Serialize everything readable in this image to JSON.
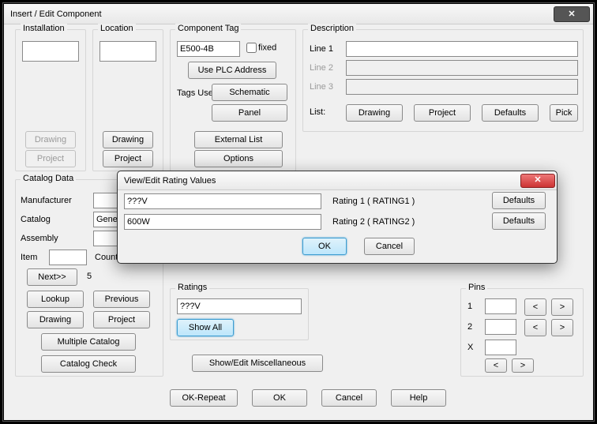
{
  "window": {
    "title": "Insert / Edit Component"
  },
  "installation": {
    "label": "Installation",
    "value": "",
    "drawing": "Drawing",
    "project": "Project"
  },
  "location": {
    "label": "Location",
    "value": "",
    "drawing": "Drawing",
    "project": "Project"
  },
  "component": {
    "label": "Component Tag",
    "tag": "E500-4B",
    "fixed_label": "fixed",
    "use_plc": "Use PLC Address",
    "tags_used": "Tags Used:",
    "schematic": "Schematic",
    "panel": "Panel",
    "external_list": "External List",
    "options": "Options"
  },
  "description": {
    "label": "Description",
    "line1_label": "Line 1",
    "line1": "",
    "line2_label": "Line 2",
    "line2": "",
    "line3_label": "Line 3",
    "line3": "",
    "list_label": "List:",
    "drawing": "Drawing",
    "project": "Project",
    "defaults": "Defaults",
    "pick": "Pick"
  },
  "catalog": {
    "label": "Catalog Data",
    "manufacturer_label": "Manufacturer",
    "manufacturer": "",
    "catalog_label": "Catalog",
    "catalog": "Generic Heater",
    "assembly_label": "Assembly",
    "assembly": "",
    "item_label": "Item",
    "item": "",
    "count_label": "Count",
    "next": "Next>>",
    "count": "5",
    "lookup": "Lookup",
    "previous": "Previous",
    "drawing": "Drawing",
    "project": "Project",
    "multiple": "Multiple Catalog",
    "check": "Catalog Check"
  },
  "ratings": {
    "label": "Ratings",
    "value": "???V",
    "show_all": "Show All"
  },
  "misc": {
    "button": "Show/Edit Miscellaneous"
  },
  "pins": {
    "label": "Pins",
    "r1": "1",
    "r2": "2",
    "rx": "X",
    "lt": "<",
    "gt": ">"
  },
  "bottom": {
    "ok_repeat": "OK-Repeat",
    "ok": "OK",
    "cancel": "Cancel",
    "help": "Help"
  },
  "modal": {
    "title": "View/Edit Rating Values",
    "r1_val": "???V",
    "r1_lbl": "Rating 1 ( RATING1 )",
    "r2_val": "600W",
    "r2_lbl": "Rating 2 ( RATING2 )",
    "defaults": "Defaults",
    "ok": "OK",
    "cancel": "Cancel"
  }
}
